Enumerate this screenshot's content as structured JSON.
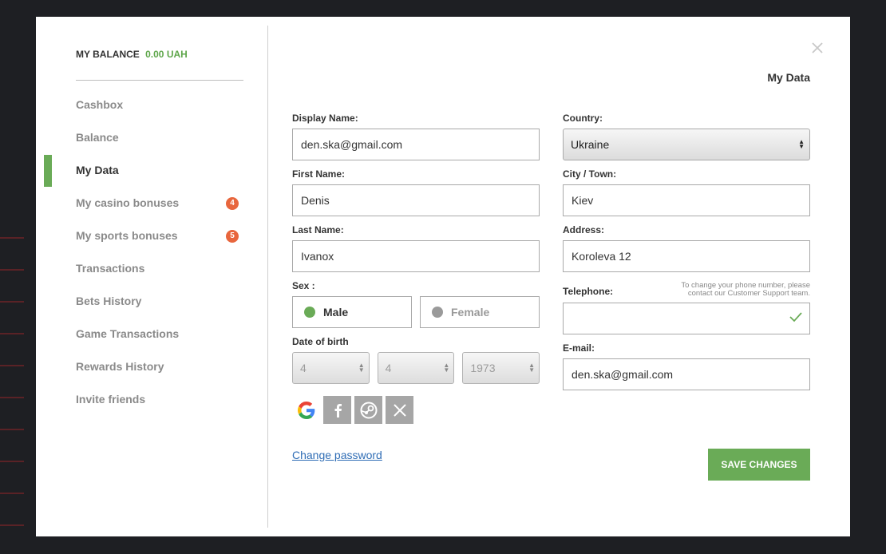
{
  "balance": {
    "label": "MY BALANCE",
    "amount": "0.00 UAH"
  },
  "sidebar": {
    "items": [
      {
        "label": "Cashbox"
      },
      {
        "label": "Balance"
      },
      {
        "label": "My Data",
        "active": true
      },
      {
        "label": "My casino bonuses",
        "badge": "4"
      },
      {
        "label": "My sports bonuses",
        "badge": "5"
      },
      {
        "label": "Transactions"
      },
      {
        "label": "Bets History"
      },
      {
        "label": "Game Transactions"
      },
      {
        "label": "Rewards History"
      },
      {
        "label": "Invite friends"
      }
    ]
  },
  "header": {
    "title": "My Data",
    "close_icon": "close-icon"
  },
  "form": {
    "display_name": {
      "label": "Display Name:",
      "value": "den.ska@gmail.com"
    },
    "first_name": {
      "label": "First Name:",
      "value": "Denis"
    },
    "last_name": {
      "label": "Last Name:",
      "value": "Ivanox"
    },
    "sex": {
      "label": "Sex :",
      "male": "Male",
      "female": "Female",
      "selected": "Male"
    },
    "dob": {
      "label": "Date of birth",
      "day": "4",
      "month": "4",
      "year": "1973"
    },
    "country": {
      "label": "Country:",
      "value": "Ukraine"
    },
    "city": {
      "label": "City / Town:",
      "value": "Kiev"
    },
    "address": {
      "label": "Address:",
      "value": "Koroleva 12"
    },
    "telephone": {
      "label": "Telephone:",
      "note": "To change your phone number, please contact our Customer Support team.",
      "value": ""
    },
    "email": {
      "label": "E-mail:",
      "value": "den.ska@gmail.com"
    }
  },
  "social": [
    "google-icon",
    "facebook-icon",
    "steam-icon",
    "x-icon"
  ],
  "actions": {
    "change_password": "Change password",
    "save": "SAVE CHANGES"
  },
  "colors": {
    "accent": "#6aab57",
    "badge": "#e8663d",
    "link": "#2f6db5"
  }
}
